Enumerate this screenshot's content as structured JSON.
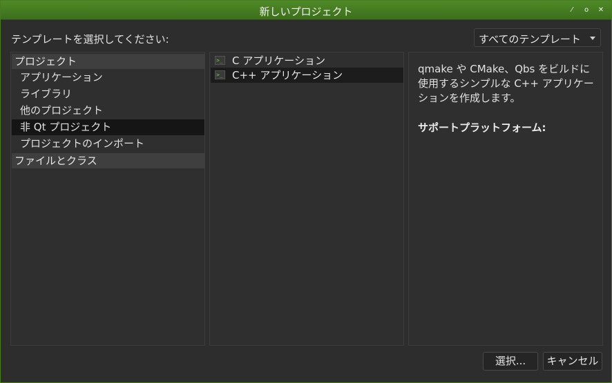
{
  "window": {
    "title": "新しいプロジェクト"
  },
  "header": {
    "label": "テンプレートを選択してください:",
    "filter": "すべてのテンプレート"
  },
  "categories": {
    "project": {
      "label": "プロジェクト",
      "items": [
        "アプリケーション",
        "ライブラリ",
        "他のプロジェクト",
        "非 Qt プロジェクト",
        "プロジェクトのインポート"
      ]
    },
    "files": {
      "label": "ファイルとクラス"
    }
  },
  "templates": [
    {
      "label": "C アプリケーション",
      "icon": "terminal-icon"
    },
    {
      "label": "C++ アプリケーション",
      "icon": "terminal-icon"
    }
  ],
  "description": {
    "text": "qmake や CMake、Qbs をビルドに使用するシンプルな C++ アプリケーションを作成します。",
    "platforms_label": "サポートプラットフォーム:"
  },
  "buttons": {
    "select": "選択...",
    "cancel": "キャンセル"
  }
}
